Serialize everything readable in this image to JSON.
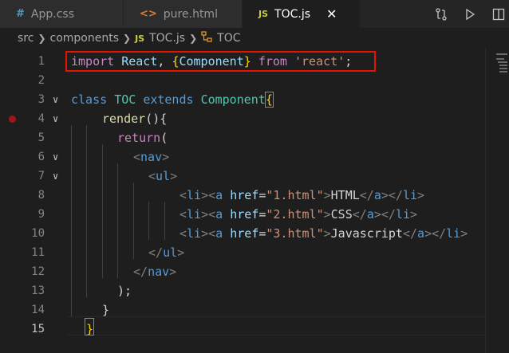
{
  "tabs": [
    {
      "icon": "#",
      "label": "App.css",
      "active": false
    },
    {
      "icon": "<>",
      "label": "pure.html",
      "active": false
    },
    {
      "icon": "JS",
      "label": "TOC.js",
      "active": true
    }
  ],
  "tab_close": "✕",
  "breadcrumb": {
    "parts": [
      "src",
      "components",
      "TOC.js",
      "TOC"
    ],
    "js_icon": "JS"
  },
  "editor": {
    "line_numbers": [
      "1",
      "2",
      "3",
      "4",
      "5",
      "6",
      "7",
      "8",
      "9",
      "10",
      "11",
      "12",
      "13",
      "14",
      "15"
    ],
    "current_line": "15",
    "lines": {
      "l1": {
        "import": "import",
        "react_ident": "React",
        "comma": ",",
        "lb": "{",
        "component": "Component",
        "rb": "}",
        "from": "from",
        "str": "'react'",
        "semi": ";"
      },
      "l3": {
        "class": "class",
        "name": "TOC",
        "extends": "extends",
        "base": "Component",
        "brace": "{"
      },
      "l4": {
        "render": "render",
        "parens": "(){"
      },
      "l5": {
        "return": "return",
        "paren": "("
      },
      "l6": {
        "lt": "<",
        "tag": "nav",
        "gt": ">"
      },
      "l7": {
        "lt": "<",
        "tag": "ul",
        "gt": ">"
      },
      "l8": {
        "li_open": "li",
        "a_open": "a",
        "attr": "href",
        "eq": "=",
        "val": "\"1.html\"",
        "text": "HTML",
        "a_close": "a",
        "li_close": "li"
      },
      "l9": {
        "li_open": "li",
        "a_open": "a",
        "attr": "href",
        "eq": "=",
        "val": "\"2.html\"",
        "text": "CSS",
        "a_close": "a",
        "li_close": "li"
      },
      "l10": {
        "li_open": "li",
        "a_open": "a",
        "attr": "href",
        "eq": "=",
        "val": "\"3.html\"",
        "text": "Javascript",
        "a_close": "a",
        "li_close": "li"
      },
      "l11": {
        "close": "</",
        "tag": "ul",
        "gt": ">"
      },
      "l12": {
        "close": "</",
        "tag": "nav",
        "gt": ">"
      },
      "l13": {
        "text": ");"
      },
      "l14": {
        "text": "}"
      },
      "l15": {
        "text": "}"
      }
    }
  },
  "colors": {
    "highlight_border": "#e51400",
    "breakpoint": "#a31515"
  }
}
